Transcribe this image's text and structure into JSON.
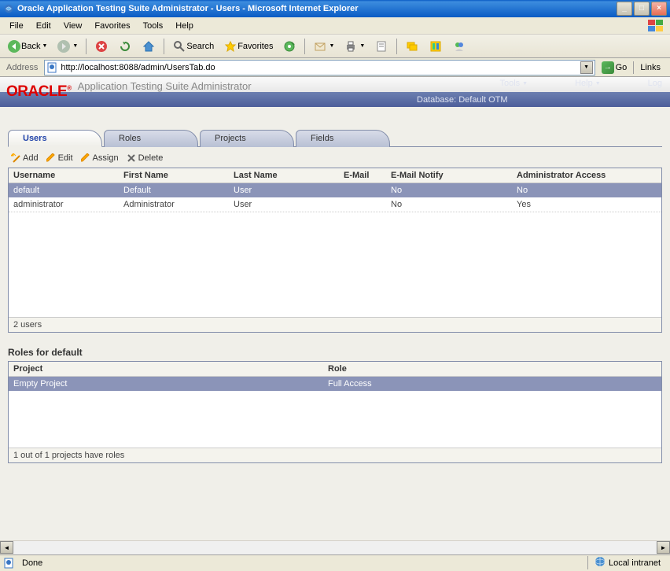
{
  "window": {
    "title": "Oracle Application Testing Suite Administrator  -  Users - Microsoft Internet Explorer"
  },
  "menubar": {
    "file": "File",
    "edit": "Edit",
    "view": "View",
    "favorites": "Favorites",
    "tools": "Tools",
    "help": "Help"
  },
  "toolbar": {
    "back": "Back",
    "search": "Search",
    "favorites": "Favorites"
  },
  "addressbar": {
    "label": "Address",
    "url": "http://localhost:8088/admin/UsersTab.do",
    "go": "Go",
    "links": "Links"
  },
  "oracle": {
    "logo": "ORACLE",
    "subtitle": "Application Testing Suite Administrator",
    "tools": "Tools",
    "help": "Help",
    "log": "Log",
    "database": "Database: Default OTM"
  },
  "tabs": {
    "users": "Users",
    "roles": "Roles",
    "projects": "Projects",
    "fields": "Fields"
  },
  "actions": {
    "add": "Add",
    "edit": "Edit",
    "assign": "Assign",
    "delete": "Delete"
  },
  "users_table": {
    "headers": {
      "username": "Username",
      "firstname": "First Name",
      "lastname": "Last Name",
      "email": "E-Mail",
      "notify": "E-Mail Notify",
      "admin": "Administrator Access"
    },
    "rows": [
      {
        "username": "default",
        "firstname": "Default",
        "lastname": "User",
        "email": "",
        "notify": "No",
        "admin": "No"
      },
      {
        "username": "administrator",
        "firstname": "Administrator",
        "lastname": "User",
        "email": "",
        "notify": "No",
        "admin": "Yes"
      }
    ],
    "footer": "2 users"
  },
  "roles_section": {
    "title": "Roles for default",
    "headers": {
      "project": "Project",
      "role": "Role"
    },
    "rows": [
      {
        "project": "Empty Project",
        "role": "Full Access"
      }
    ],
    "footer": "1 out of 1 projects have roles"
  },
  "statusbar": {
    "text": "Done",
    "zone": "Local intranet"
  }
}
